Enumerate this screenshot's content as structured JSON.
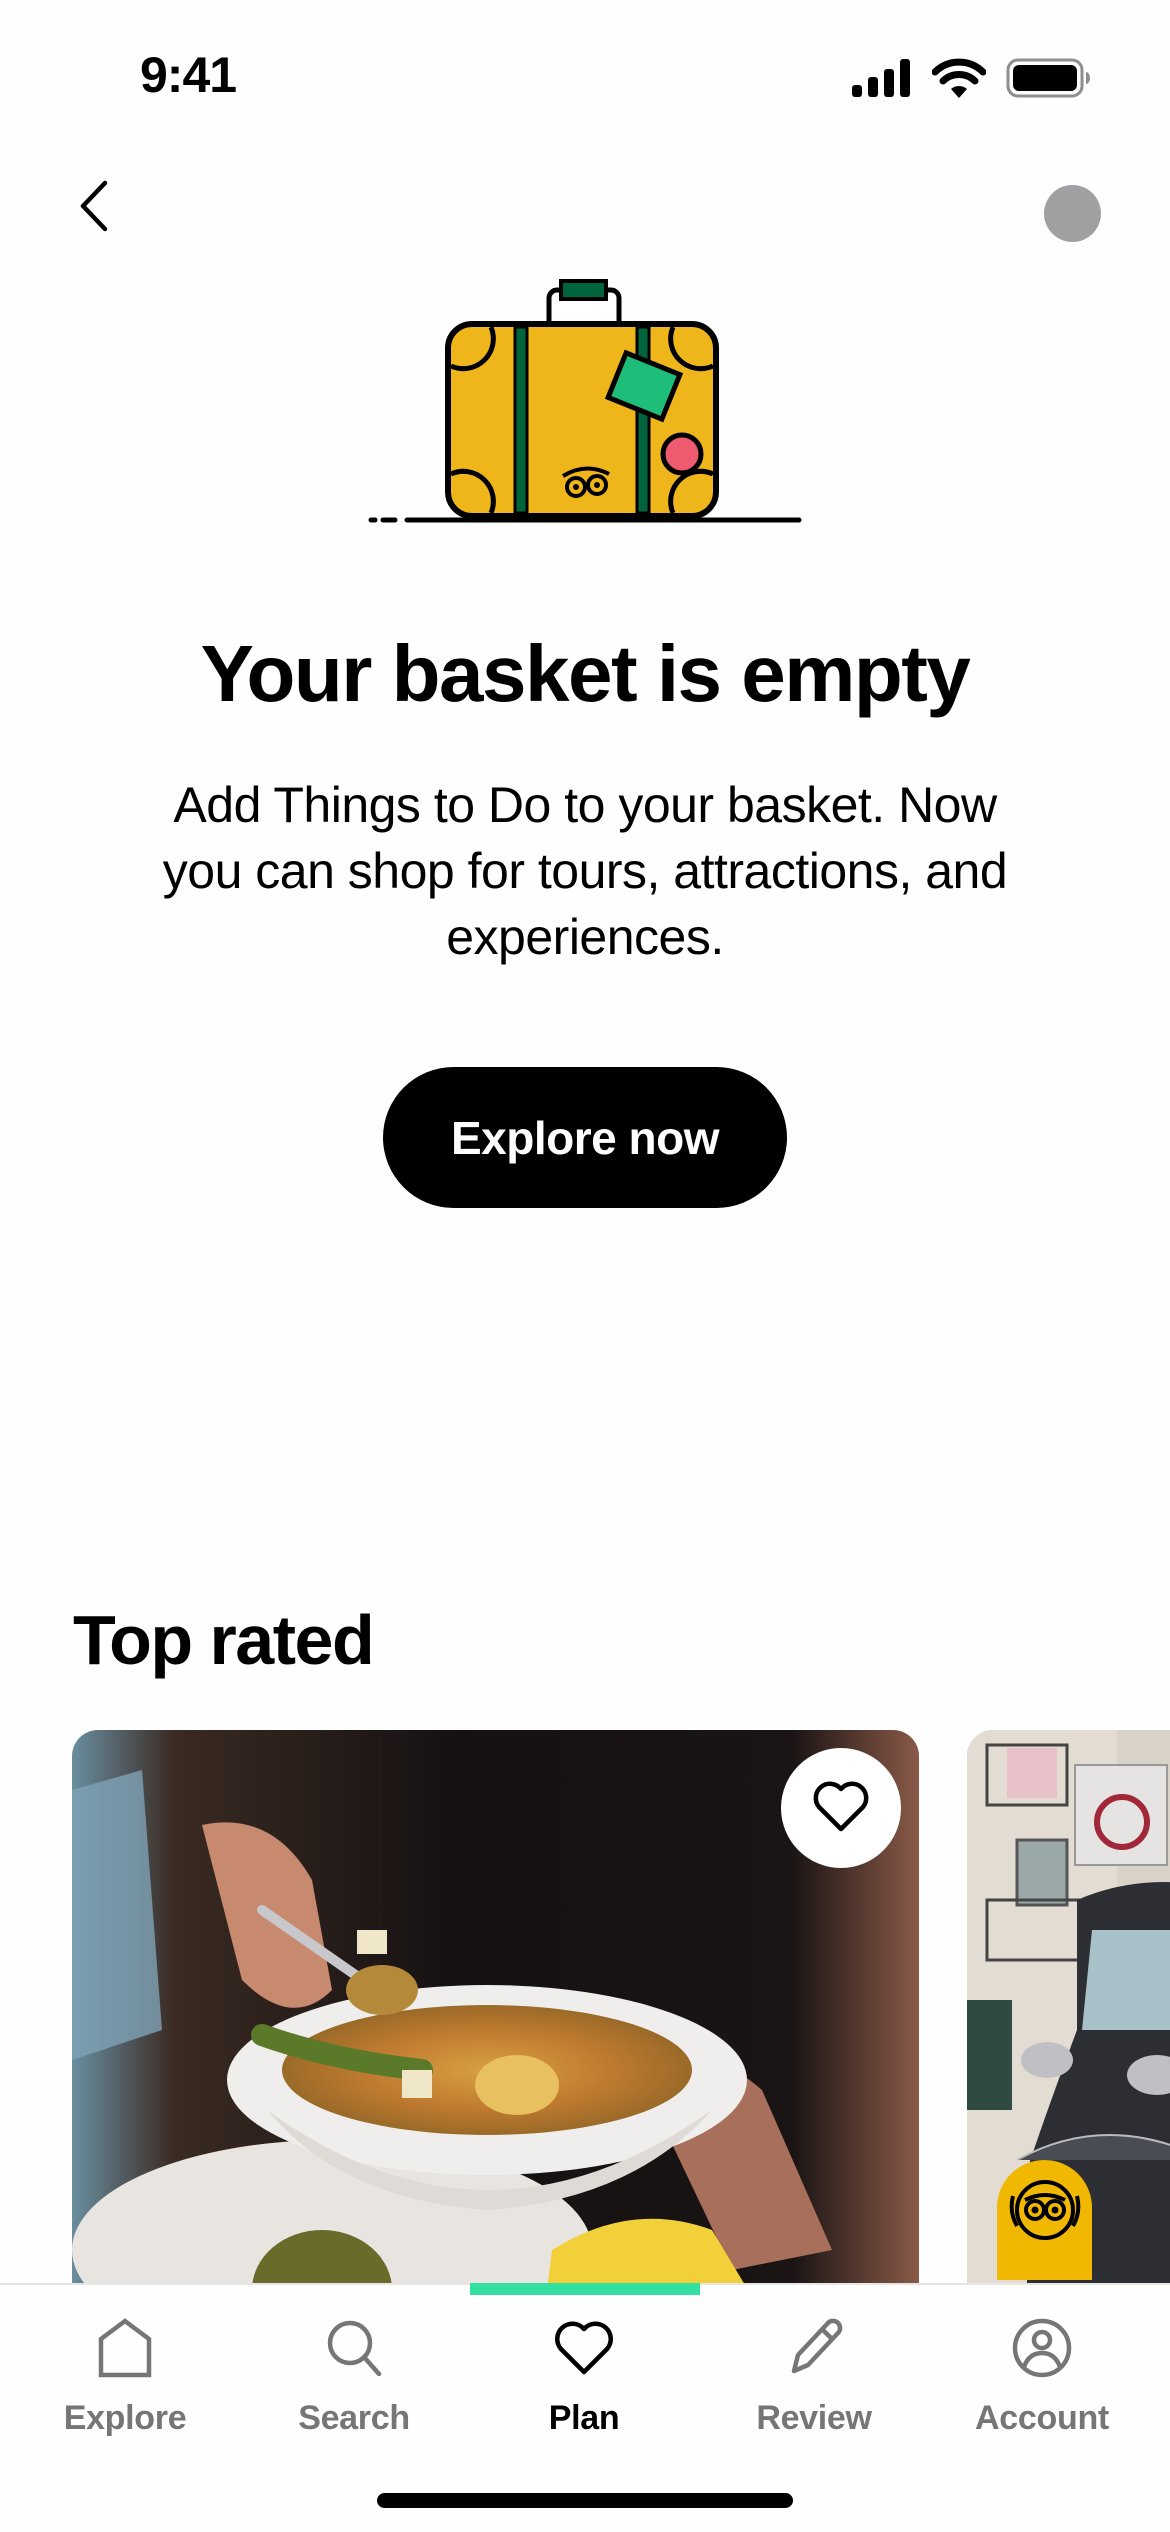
{
  "status_bar": {
    "time": "9:41",
    "icons": [
      "cellular-signal-icon",
      "wifi-icon",
      "battery-icon"
    ]
  },
  "nav": {
    "back_icon": "chevron-left-icon",
    "avatar_color": "#a0a0a2"
  },
  "empty_state": {
    "illustration": "suitcase-illustration",
    "title": "Your basket is empty",
    "body": "Add Things to Do to your basket. Now you can shop for tours, attractions, and experiences.",
    "cta_label": "Explore now"
  },
  "top_rated": {
    "title": "Top rated",
    "cards": [
      {
        "image": "food-bowl-photo",
        "favorite_icon": "heart-outline-icon",
        "favorited": false
      },
      {
        "image": "tuk-tuk-street-photo",
        "badge": "travelers-choice-badge"
      }
    ]
  },
  "tab_bar": {
    "active_index": 2,
    "accent_color": "#34e0a1",
    "tabs": [
      {
        "label": "Explore",
        "icon": "home-icon"
      },
      {
        "label": "Search",
        "icon": "search-icon"
      },
      {
        "label": "Plan",
        "icon": "heart-icon"
      },
      {
        "label": "Review",
        "icon": "pencil-icon"
      },
      {
        "label": "Account",
        "icon": "account-icon"
      }
    ]
  },
  "colors": {
    "suitcase_body": "#efb61c",
    "suitcase_strap": "#00643c",
    "sticker_green": "#1fbd7a",
    "sticker_pink": "#ef5a6e",
    "badge_yellow": "#f0b800"
  }
}
